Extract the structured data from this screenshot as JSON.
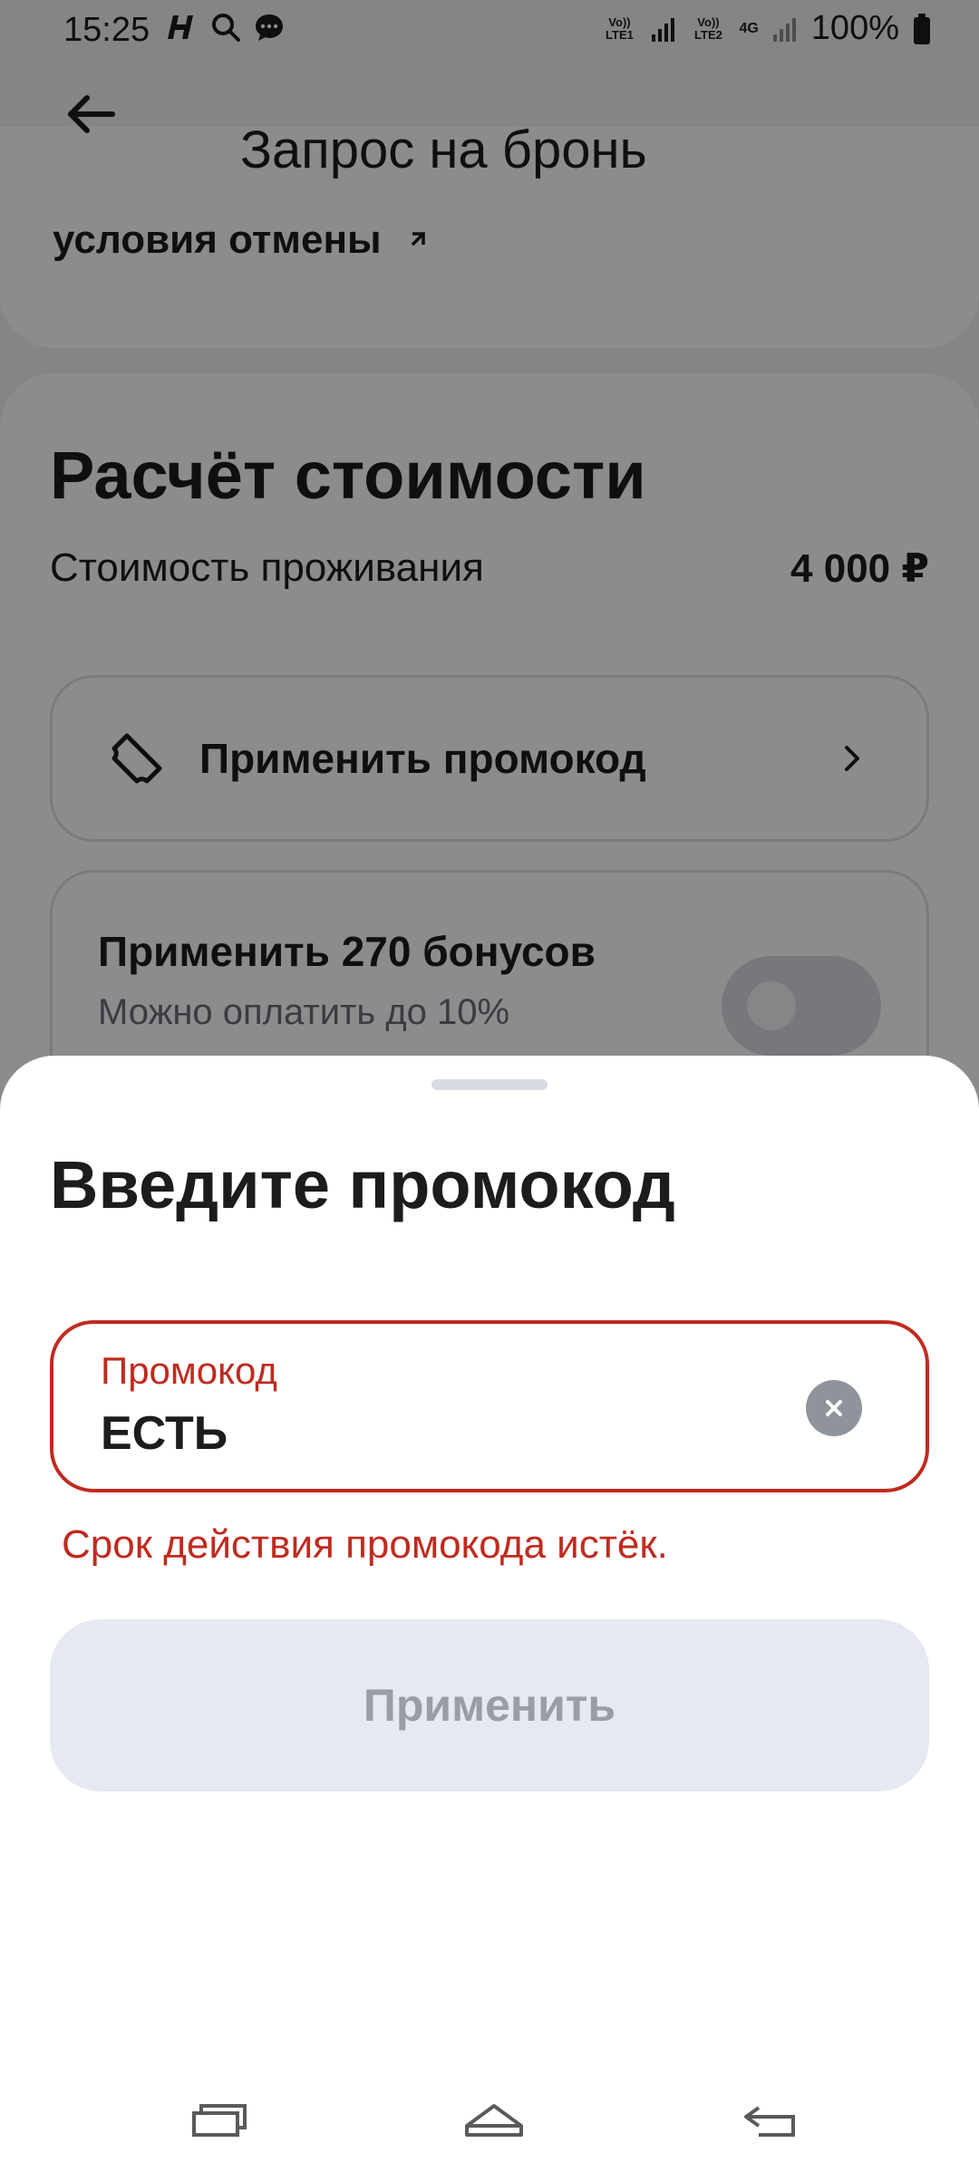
{
  "status_bar": {
    "time": "15:25",
    "sim1": "Vo)) LTE1",
    "sim2": "Vo)) LTE2",
    "net": "4G",
    "battery": "100%"
  },
  "header": {
    "title": "Запрос на бронь"
  },
  "cancel_conditions": {
    "label": "условия отмены"
  },
  "cost": {
    "title": "Расчёт стоимости",
    "row_label": "Стоимость проживания",
    "row_value": "4 000 ₽",
    "promo_row_label": "Применить промокод",
    "bonus_title": "Применить 270 бонусов",
    "bonus_subtitle": "Можно оплатить до 10%",
    "bonus_enabled": false
  },
  "sheet": {
    "title": "Введите промокод",
    "field_label": "Промокод",
    "field_value": "ЕСТЬ",
    "error": "Срок действия промокода истёк.",
    "apply_label": "Применить"
  },
  "colors": {
    "error": "#c02b1f",
    "disabled_button_bg": "#e6e8f2",
    "disabled_button_text": "#9a9da6"
  },
  "icons": [
    "back-arrow-icon",
    "chevron-right-icon",
    "ticket-icon",
    "clear-icon",
    "recent-apps-icon",
    "home-icon",
    "nav-back-icon"
  ]
}
